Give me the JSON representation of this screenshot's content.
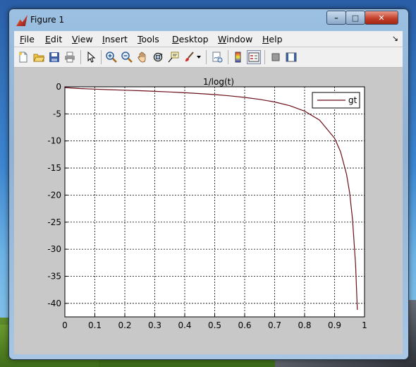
{
  "window": {
    "title": "Figure 1",
    "controls": {
      "minimize": "–",
      "maximize": "□",
      "close": "✕"
    }
  },
  "menubar": {
    "items": [
      {
        "label": "File",
        "mnemonic": "F"
      },
      {
        "label": "Edit",
        "mnemonic": "E"
      },
      {
        "label": "View",
        "mnemonic": "V"
      },
      {
        "label": "Insert",
        "mnemonic": "I"
      },
      {
        "label": "Tools",
        "mnemonic": "T"
      },
      {
        "label": "Desktop",
        "mnemonic": "D"
      },
      {
        "label": "Window",
        "mnemonic": "W"
      },
      {
        "label": "Help",
        "mnemonic": "H"
      }
    ],
    "dock_arrow": "↘"
  },
  "toolbar": {
    "buttons": [
      {
        "icon": "new-figure-icon"
      },
      {
        "icon": "open-file-icon"
      },
      {
        "icon": "save-icon"
      },
      {
        "icon": "print-icon"
      },
      {
        "icon": "edit-plot-arrow-icon"
      },
      {
        "icon": "zoom-in-icon"
      },
      {
        "icon": "zoom-out-icon"
      },
      {
        "icon": "pan-hand-icon"
      },
      {
        "icon": "rotate-3d-icon"
      },
      {
        "icon": "data-cursor-icon"
      },
      {
        "icon": "brush-icon"
      },
      {
        "icon": "link-plot-icon"
      },
      {
        "icon": "insert-colorbar-icon"
      },
      {
        "icon": "insert-legend-icon"
      },
      {
        "icon": "hide-plot-tools-icon"
      },
      {
        "icon": "show-plot-tools-icon"
      }
    ]
  },
  "chart_data": {
    "type": "line",
    "title": "1/log(t)",
    "xlabel": "",
    "ylabel": "",
    "xlim": [
      0,
      1
    ],
    "ylim": [
      -42.5,
      0
    ],
    "xticks": [
      "0",
      "0.1",
      "0.2",
      "0.3",
      "0.4",
      "0.5",
      "0.6",
      "0.7",
      "0.8",
      "0.9",
      "1"
    ],
    "yticks": [
      "0",
      "-5",
      "-10",
      "-15",
      "-20",
      "-25",
      "-30",
      "-35",
      "-40"
    ],
    "grid": true,
    "grid_style": "dotted",
    "legend": "top-right",
    "series": [
      {
        "name": "gt",
        "color": "#6b0f1a",
        "x": [
          0.001,
          0.05,
          0.1,
          0.15,
          0.2,
          0.25,
          0.3,
          0.35,
          0.4,
          0.45,
          0.5,
          0.55,
          0.6,
          0.65,
          0.7,
          0.75,
          0.8,
          0.85,
          0.9,
          0.92,
          0.94,
          0.95,
          0.96,
          0.97,
          0.976
        ],
        "y": [
          -0.14,
          -0.33,
          -0.43,
          -0.53,
          -0.62,
          -0.72,
          -0.83,
          -0.95,
          -1.09,
          -1.25,
          -1.44,
          -1.67,
          -1.96,
          -2.32,
          -2.8,
          -3.48,
          -4.48,
          -6.15,
          -9.49,
          -11.99,
          -16.16,
          -19.5,
          -24.5,
          -32.8,
          -41.2
        ]
      }
    ]
  }
}
